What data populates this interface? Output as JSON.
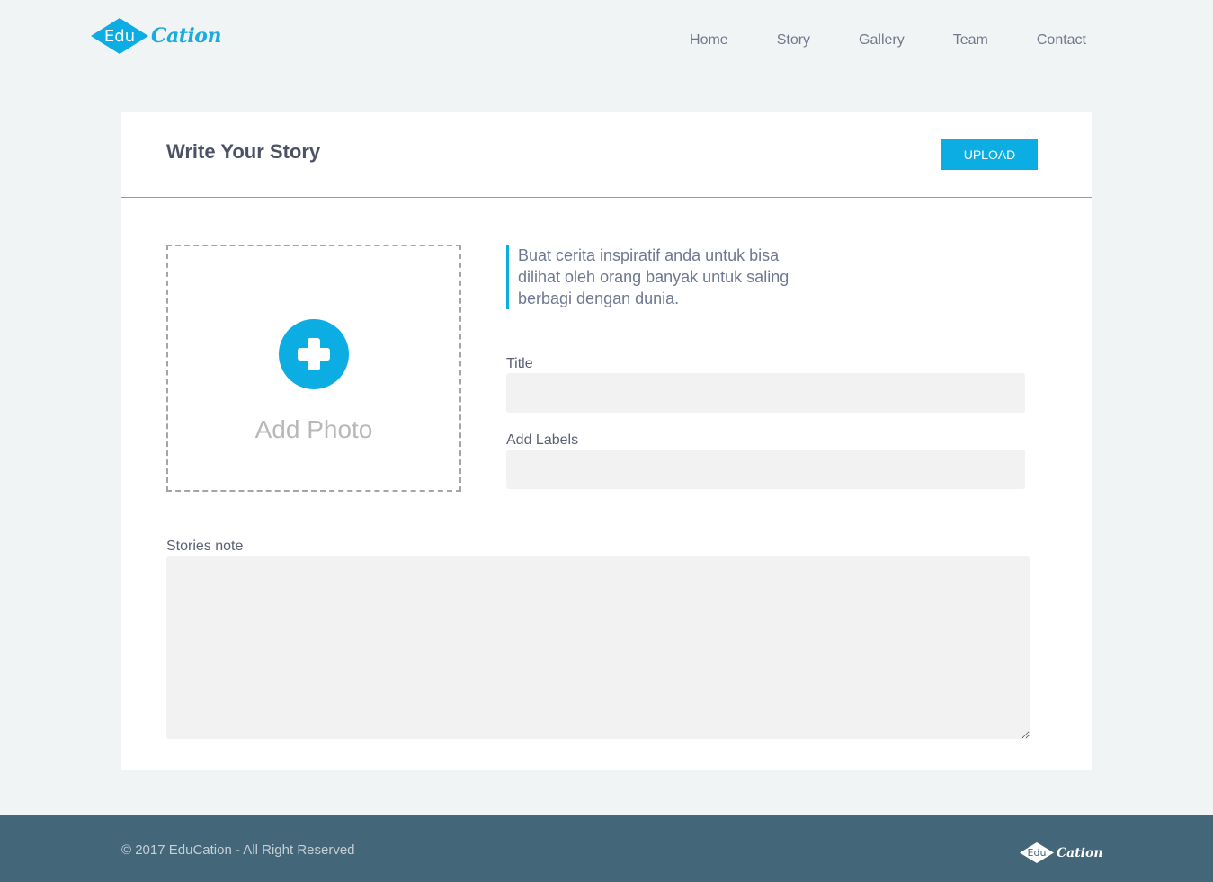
{
  "brand": {
    "logo_part1": "Edu",
    "logo_part2": "Cation",
    "accent_color": "#0bade2"
  },
  "nav": {
    "items": [
      "Home",
      "Story",
      "Gallery",
      "Team",
      "Contact"
    ]
  },
  "card": {
    "title": "Write Your Story",
    "upload_label": "UPLOAD",
    "photo": {
      "label": "Add Photo",
      "icon": "plus-circle-icon"
    },
    "quote_lines": [
      "Buat cerita inspiratif anda untuk bisa",
      "dilihat oleh orang banyak untuk saling",
      "berbagi dengan dunia."
    ],
    "fields": {
      "title_label": "Title",
      "title_value": "",
      "labels_label": "Add Labels",
      "labels_value": "",
      "notes_label": "Stories note",
      "notes_value": ""
    }
  },
  "footer": {
    "copyright": "© 2017 EduCation - All Right Reserved",
    "logo_part1": "Edu",
    "logo_part2": "Cation"
  }
}
